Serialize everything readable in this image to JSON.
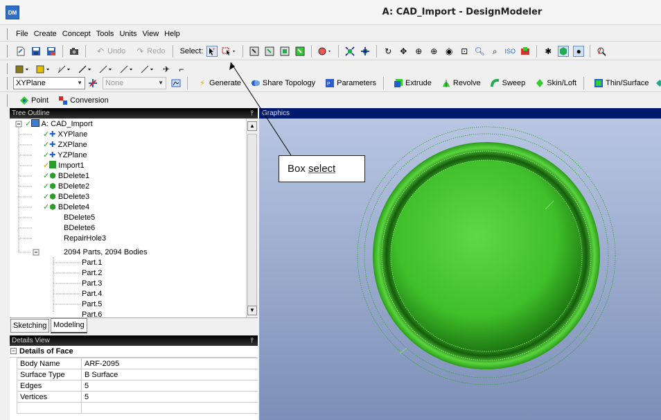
{
  "app": {
    "icon_text": "DM",
    "title": "A: CAD_Import - DesignModeler"
  },
  "menu": [
    "File",
    "Create",
    "Concept",
    "Tools",
    "Units",
    "View",
    "Help"
  ],
  "toolbar1": {
    "undo": "Undo",
    "redo": "Redo",
    "select_label": "Select:"
  },
  "toolbar3": {
    "plane_value": "XYPlane",
    "sketch_value": "None",
    "generate": "Generate",
    "share_topology": "Share Topology",
    "parameters": "Parameters",
    "extrude": "Extrude",
    "revolve": "Revolve",
    "sweep": "Sweep",
    "skin_loft": "Skin/Loft",
    "thin_surface": "Thin/Surface"
  },
  "toolbar4": {
    "point": "Point",
    "conversion": "Conversion"
  },
  "tree": {
    "header": "Tree Outline",
    "items": [
      "A: CAD_Import",
      "XYPlane",
      "ZXPlane",
      "YZPlane",
      "Import1",
      "BDelete1",
      "BDelete2",
      "BDelete3",
      "BDelete4",
      "BDelete5",
      "BDelete6",
      "RepairHole3",
      "2094 Parts, 2094 Bodies",
      "Part.1",
      "Part.2",
      "Part.3",
      "Part.4",
      "Part.5",
      "Part.6"
    ]
  },
  "tabs": {
    "sketching": "Sketching",
    "modeling": "Modeling"
  },
  "details": {
    "header": "Details View",
    "group": "Details of Face",
    "rows": [
      {
        "label": "Body Name",
        "value": "ARF-2095"
      },
      {
        "label": "Surface Type",
        "value": "B Surface"
      },
      {
        "label": "Edges",
        "value": "5"
      },
      {
        "label": "Vertices",
        "value": "5"
      }
    ]
  },
  "graphics": {
    "header": "Graphics"
  },
  "annotation": {
    "prefix": "Box ",
    "link": "select"
  },
  "colors": {
    "accent": "#2f6fc9",
    "model_green": "#3fbf2a",
    "graphics_header": "#001a6e"
  }
}
